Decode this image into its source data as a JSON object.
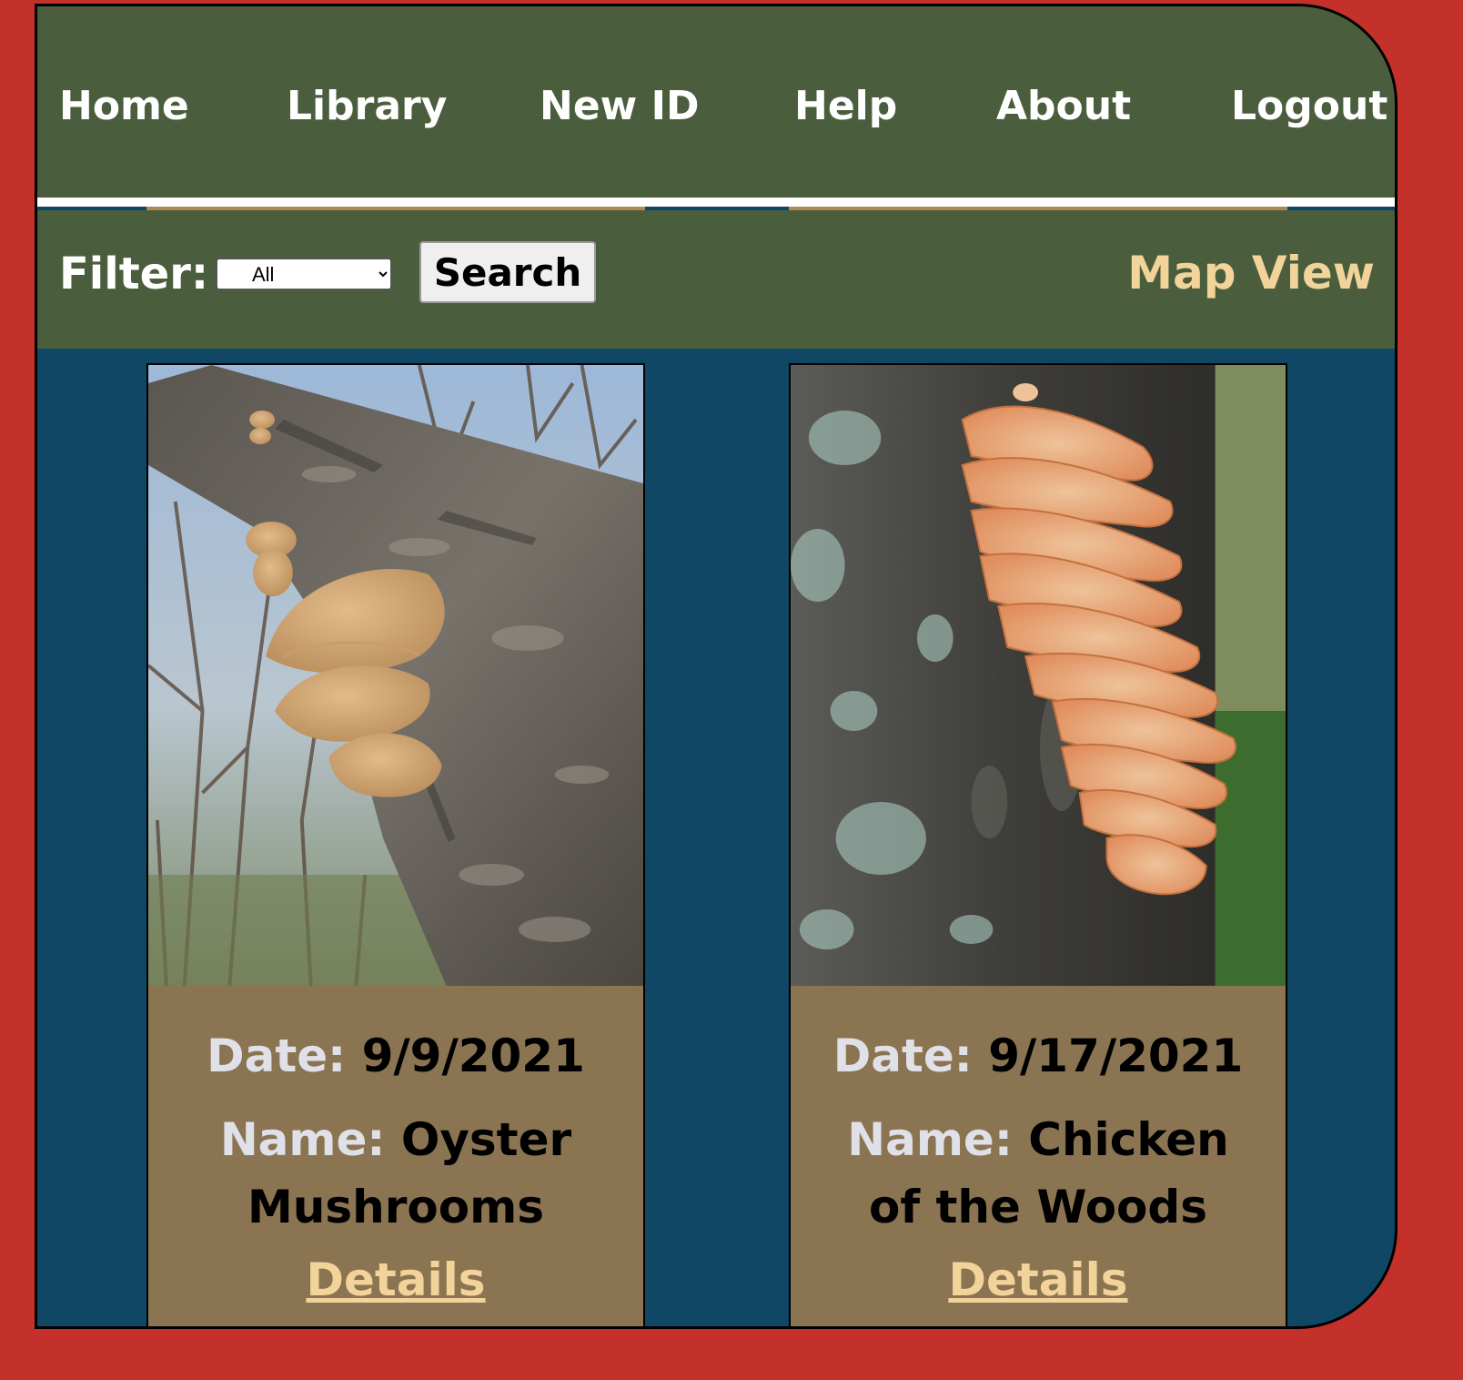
{
  "nav": {
    "items": [
      {
        "label": "Home"
      },
      {
        "label": "Library"
      },
      {
        "label": "New ID"
      },
      {
        "label": "Help"
      },
      {
        "label": "About"
      },
      {
        "label": "Logout"
      }
    ]
  },
  "filter": {
    "label": "Filter:",
    "selected": "All",
    "search_label": "Search",
    "map_view_label": "Map View"
  },
  "cards": [
    {
      "date_label": "Date:",
      "date": "9/9/2021",
      "name_label": "Name:",
      "name": "Oyster Mushrooms",
      "details_label": "Details"
    },
    {
      "date_label": "Date:",
      "date": "9/17/2021",
      "name_label": "Name:",
      "name": "Chicken of the Woods",
      "details_label": "Details"
    }
  ],
  "colors": {
    "outer_background": "#c4302a",
    "nav_background": "#4a5e3d",
    "content_background": "#0f4765",
    "card_footer": "#8b7451",
    "accent_link": "#f2d49b",
    "label_text": "#e0e0e8"
  }
}
